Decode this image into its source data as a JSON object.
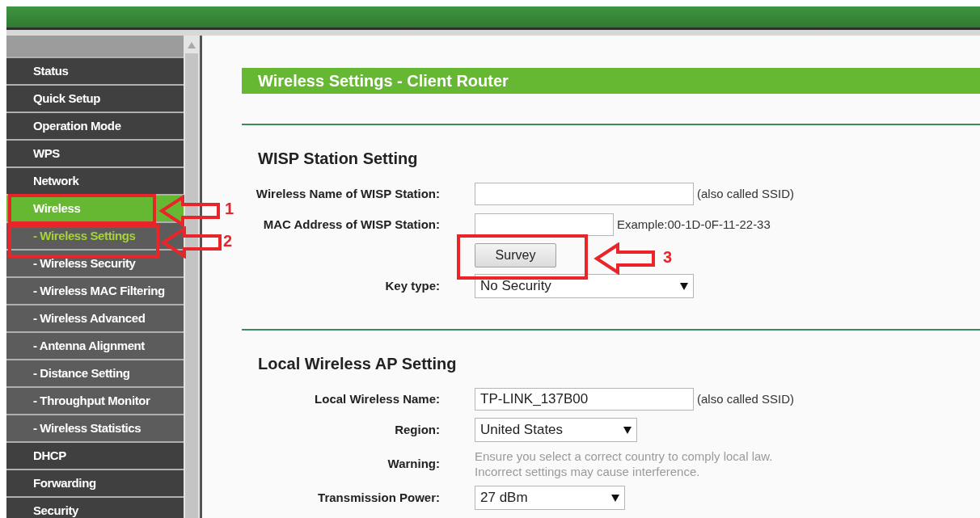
{
  "sidebar": {
    "items": [
      {
        "label": "Status",
        "selected": false
      },
      {
        "label": "Quick Setup",
        "selected": false
      },
      {
        "label": "Operation Mode",
        "selected": false
      },
      {
        "label": "WPS",
        "selected": false
      },
      {
        "label": "Network",
        "selected": false
      },
      {
        "label": "Wireless",
        "selected": true,
        "children": [
          {
            "label": "- Wireless Settings",
            "selected": true
          },
          {
            "label": "- Wireless Security",
            "selected": false
          },
          {
            "label": "- Wireless MAC Filtering",
            "selected": false
          },
          {
            "label": "- Wireless Advanced",
            "selected": false
          },
          {
            "label": "- Antenna Alignment",
            "selected": false
          },
          {
            "label": "- Distance Setting",
            "selected": false
          },
          {
            "label": "- Throughput Monitor",
            "selected": false
          },
          {
            "label": "- Wireless Statistics",
            "selected": false
          }
        ]
      },
      {
        "label": "DHCP",
        "selected": false
      },
      {
        "label": "Forwarding",
        "selected": false
      },
      {
        "label": "Security",
        "selected": false
      }
    ]
  },
  "page_title": "Wireless Settings - Client Router",
  "sections": [
    {
      "heading": "WISP Station Setting",
      "fields": [
        {
          "kind": "input",
          "label": "Wireless Name of WISP Station:",
          "hint": "(also called SSID)"
        },
        {
          "kind": "input",
          "label": "MAC Address of WISP Station:",
          "hint": "Example:00-1D-0F-11-22-33"
        },
        {
          "kind": "button",
          "label": "Survey"
        },
        {
          "kind": "select",
          "label": "Key type:",
          "value": "No Security"
        }
      ]
    },
    {
      "heading": "Local Wireless AP Setting",
      "fields": [
        {
          "kind": "input",
          "label": "Local Wireless Name:",
          "value": "TP-LINK_137B00",
          "hint": "(also called SSID)"
        },
        {
          "kind": "select",
          "label": "Region:",
          "value": "United States"
        },
        {
          "kind": "note",
          "label": "Warning:",
          "lines": [
            "Ensure you select a correct country to comply local law.",
            "Incorrect settings may cause interference."
          ]
        },
        {
          "kind": "select",
          "label": "Transmission Power:",
          "value": "27 dBm"
        }
      ]
    }
  ],
  "annotations": [
    {
      "label": "1"
    },
    {
      "label": "2"
    },
    {
      "label": "3"
    }
  ]
}
